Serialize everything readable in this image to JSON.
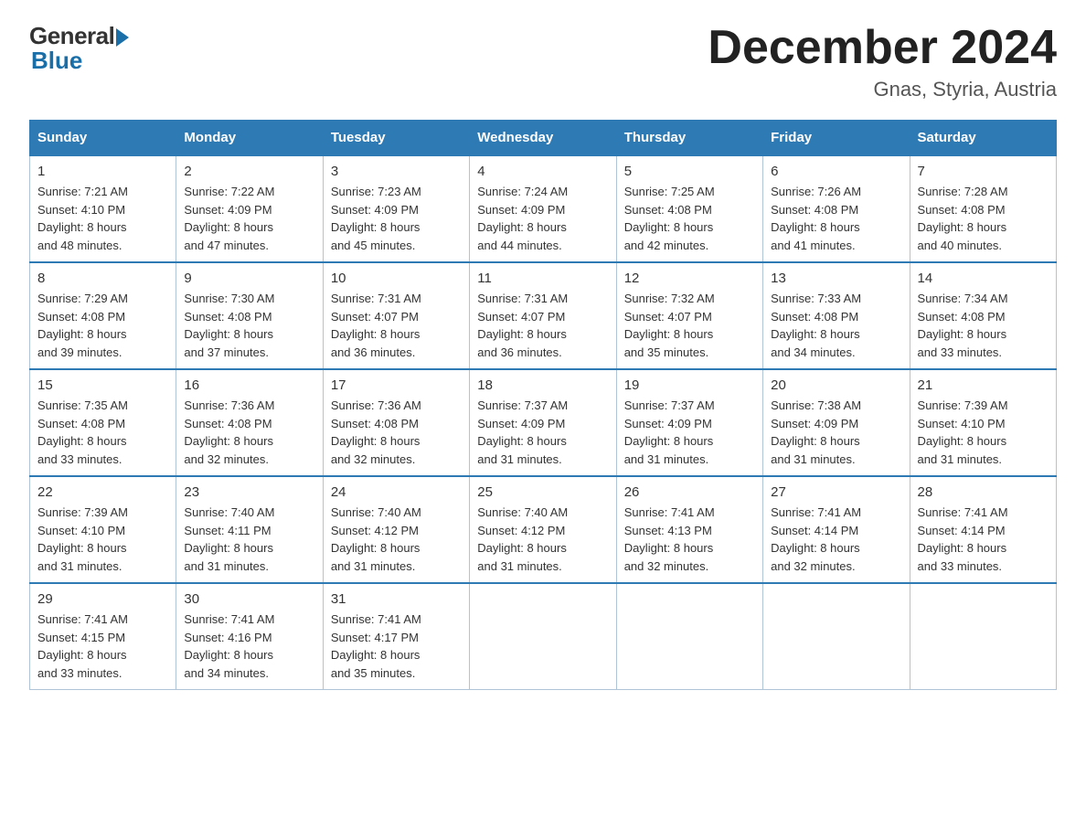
{
  "logo": {
    "general": "General",
    "blue": "Blue"
  },
  "header": {
    "title": "December 2024",
    "subtitle": "Gnas, Styria, Austria"
  },
  "weekdays": [
    "Sunday",
    "Monday",
    "Tuesday",
    "Wednesday",
    "Thursday",
    "Friday",
    "Saturday"
  ],
  "weeks": [
    [
      {
        "day": "1",
        "sunrise": "7:21 AM",
        "sunset": "4:10 PM",
        "daylight": "8 hours and 48 minutes."
      },
      {
        "day": "2",
        "sunrise": "7:22 AM",
        "sunset": "4:09 PM",
        "daylight": "8 hours and 47 minutes."
      },
      {
        "day": "3",
        "sunrise": "7:23 AM",
        "sunset": "4:09 PM",
        "daylight": "8 hours and 45 minutes."
      },
      {
        "day": "4",
        "sunrise": "7:24 AM",
        "sunset": "4:09 PM",
        "daylight": "8 hours and 44 minutes."
      },
      {
        "day": "5",
        "sunrise": "7:25 AM",
        "sunset": "4:08 PM",
        "daylight": "8 hours and 42 minutes."
      },
      {
        "day": "6",
        "sunrise": "7:26 AM",
        "sunset": "4:08 PM",
        "daylight": "8 hours and 41 minutes."
      },
      {
        "day": "7",
        "sunrise": "7:28 AM",
        "sunset": "4:08 PM",
        "daylight": "8 hours and 40 minutes."
      }
    ],
    [
      {
        "day": "8",
        "sunrise": "7:29 AM",
        "sunset": "4:08 PM",
        "daylight": "8 hours and 39 minutes."
      },
      {
        "day": "9",
        "sunrise": "7:30 AM",
        "sunset": "4:08 PM",
        "daylight": "8 hours and 37 minutes."
      },
      {
        "day": "10",
        "sunrise": "7:31 AM",
        "sunset": "4:07 PM",
        "daylight": "8 hours and 36 minutes."
      },
      {
        "day": "11",
        "sunrise": "7:31 AM",
        "sunset": "4:07 PM",
        "daylight": "8 hours and 36 minutes."
      },
      {
        "day": "12",
        "sunrise": "7:32 AM",
        "sunset": "4:07 PM",
        "daylight": "8 hours and 35 minutes."
      },
      {
        "day": "13",
        "sunrise": "7:33 AM",
        "sunset": "4:08 PM",
        "daylight": "8 hours and 34 minutes."
      },
      {
        "day": "14",
        "sunrise": "7:34 AM",
        "sunset": "4:08 PM",
        "daylight": "8 hours and 33 minutes."
      }
    ],
    [
      {
        "day": "15",
        "sunrise": "7:35 AM",
        "sunset": "4:08 PM",
        "daylight": "8 hours and 33 minutes."
      },
      {
        "day": "16",
        "sunrise": "7:36 AM",
        "sunset": "4:08 PM",
        "daylight": "8 hours and 32 minutes."
      },
      {
        "day": "17",
        "sunrise": "7:36 AM",
        "sunset": "4:08 PM",
        "daylight": "8 hours and 32 minutes."
      },
      {
        "day": "18",
        "sunrise": "7:37 AM",
        "sunset": "4:09 PM",
        "daylight": "8 hours and 31 minutes."
      },
      {
        "day": "19",
        "sunrise": "7:37 AM",
        "sunset": "4:09 PM",
        "daylight": "8 hours and 31 minutes."
      },
      {
        "day": "20",
        "sunrise": "7:38 AM",
        "sunset": "4:09 PM",
        "daylight": "8 hours and 31 minutes."
      },
      {
        "day": "21",
        "sunrise": "7:39 AM",
        "sunset": "4:10 PM",
        "daylight": "8 hours and 31 minutes."
      }
    ],
    [
      {
        "day": "22",
        "sunrise": "7:39 AM",
        "sunset": "4:10 PM",
        "daylight": "8 hours and 31 minutes."
      },
      {
        "day": "23",
        "sunrise": "7:40 AM",
        "sunset": "4:11 PM",
        "daylight": "8 hours and 31 minutes."
      },
      {
        "day": "24",
        "sunrise": "7:40 AM",
        "sunset": "4:12 PM",
        "daylight": "8 hours and 31 minutes."
      },
      {
        "day": "25",
        "sunrise": "7:40 AM",
        "sunset": "4:12 PM",
        "daylight": "8 hours and 31 minutes."
      },
      {
        "day": "26",
        "sunrise": "7:41 AM",
        "sunset": "4:13 PM",
        "daylight": "8 hours and 32 minutes."
      },
      {
        "day": "27",
        "sunrise": "7:41 AM",
        "sunset": "4:14 PM",
        "daylight": "8 hours and 32 minutes."
      },
      {
        "day": "28",
        "sunrise": "7:41 AM",
        "sunset": "4:14 PM",
        "daylight": "8 hours and 33 minutes."
      }
    ],
    [
      {
        "day": "29",
        "sunrise": "7:41 AM",
        "sunset": "4:15 PM",
        "daylight": "8 hours and 33 minutes."
      },
      {
        "day": "30",
        "sunrise": "7:41 AM",
        "sunset": "4:16 PM",
        "daylight": "8 hours and 34 minutes."
      },
      {
        "day": "31",
        "sunrise": "7:41 AM",
        "sunset": "4:17 PM",
        "daylight": "8 hours and 35 minutes."
      },
      null,
      null,
      null,
      null
    ]
  ],
  "labels": {
    "sunrise": "Sunrise:",
    "sunset": "Sunset:",
    "daylight": "Daylight:"
  }
}
